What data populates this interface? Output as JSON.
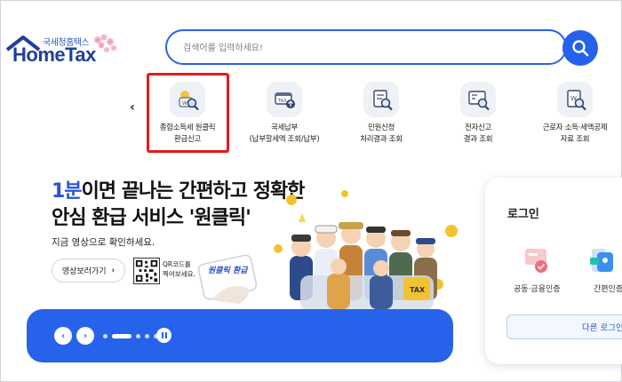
{
  "header": {
    "logo_ko": "국세청홈택스",
    "logo_en": "HomeTax",
    "search_placeholder": "검색어를 입력하세요!"
  },
  "quick_menu": [
    {
      "line1": "종합소득세 원클릭",
      "line2": "환급신고",
      "icon": "refund-search-icon"
    },
    {
      "line1": "국세납부",
      "line2": "(납부할세액 조회/납부)",
      "icon": "tax-payment-icon"
    },
    {
      "line1": "민원신청",
      "line2": "처리결과 조회",
      "icon": "civil-petition-icon"
    },
    {
      "line1": "전자신고",
      "line2": "결과 조회",
      "icon": "e-filing-result-icon"
    },
    {
      "line1": "근로자 소득·세액공제",
      "line2": "자료 조회",
      "icon": "worker-deduction-icon"
    }
  ],
  "promo": {
    "headline_blue": "1분",
    "headline_line1_rest": "이면 끝나는 간편하고 정확한",
    "headline_line2": "안심 환급 서비스 '원클릭'",
    "subtext": "지금 영상으로 확인하세요.",
    "video_button": "영상보러가기",
    "qr_text_line1": "QR코드를",
    "qr_text_line2": "찍어보세요.",
    "art_tag": "원클릭 환급"
  },
  "slider": {
    "slide_count": 5,
    "active_index": 1
  },
  "login": {
    "title": "로그인",
    "cert_label": "공동·금융인증",
    "simple_label": "간편인증",
    "other_button": "다른 로그인"
  },
  "colors": {
    "primary": "#2763ea",
    "logo_navy": "#1f3f9d",
    "highlight_red": "#e51b1b"
  }
}
